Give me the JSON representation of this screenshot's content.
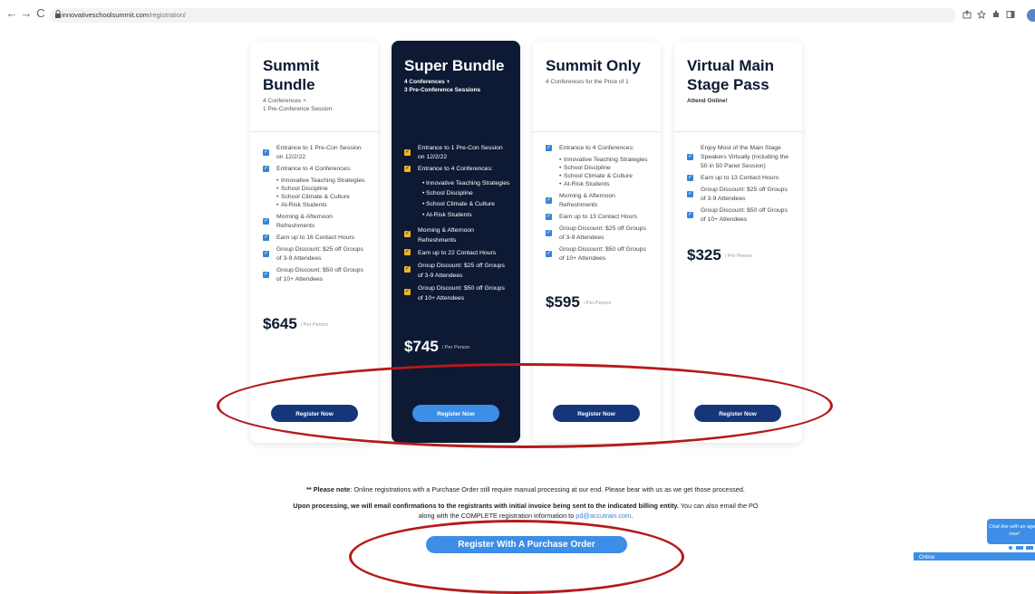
{
  "browser": {
    "url_host": "innovativeschoolsummit.com",
    "url_path": "/registration/",
    "back_glyph": "←",
    "forward_glyph": "→",
    "reload_glyph": "C"
  },
  "cards": [
    {
      "title": "Summit Bundle",
      "subtitle": "4 Conferences +\n1 Pre-Conference Session",
      "features": [
        {
          "text": "Entrance to 1 Pre-Con Session on 12/2/22"
        },
        {
          "text": "Entrance to 4 Conferences:"
        }
      ],
      "bullets": [
        "Innovative Teaching Strategies",
        "School Discipline",
        "School Climate & Culture",
        "At-Risk Students"
      ],
      "features_after": [
        {
          "text": "Morning & Afternoon Refreshments"
        },
        {
          "text": "Earn up to 16 Contact Hours"
        },
        {
          "text": "Group Discount: $25 off Groups of 3-9 Attendees"
        },
        {
          "text": "Group Discount: $50 off Groups of 10+ Attendees"
        }
      ],
      "price": "$645",
      "per": "/ Per Person",
      "button": "Register Now"
    },
    {
      "title": "Super Bundle",
      "subtitle": "4 Conferences +\n3 Pre-Conference Sessions",
      "features": [
        {
          "text": "Entrance to 1 Pre-Con Session on 12/2/22"
        },
        {
          "text": "Entrance to 4 Conferences:"
        }
      ],
      "bullets": [
        "Innovative Teaching Strategies",
        "School Discipline",
        "School Climate & Culture",
        "At-Risk Students"
      ],
      "features_after": [
        {
          "text": "Morning & Afternoon Refreshments"
        },
        {
          "text": "Earn up to 22 Contact Hours"
        },
        {
          "text": "Group Discount: $25 off Groups of 3-9 Attendees"
        },
        {
          "text": "Group Discount: $50 off Groups of 10+ Attendees"
        }
      ],
      "price": "$745",
      "per": "/ Per Person",
      "button": "Register Now"
    },
    {
      "title": "Summit Only",
      "subtitle": "4 Conferences for the Price of 1",
      "features": [
        {
          "text": "Entrance to 4 Conferences:"
        }
      ],
      "bullets": [
        "Innovative Teaching Strategies",
        "School Discipline",
        "School Climate & Culture",
        "At-Risk Students"
      ],
      "features_after": [
        {
          "text": "Morning & Afternoon Refreshments"
        },
        {
          "text": "Earn up to 13 Contact Hours"
        },
        {
          "text": "Group Discount: $25 off Groups of 3-9 Attendees"
        },
        {
          "text": "Group Discount: $50 off Groups of 10+ Attendees"
        }
      ],
      "price": "$595",
      "per": "/ Per Person",
      "button": "Register Now"
    },
    {
      "title": "Virtual Main Stage Pass",
      "subtitle": "Attend Online!",
      "features": [
        {
          "text": "Enjoy Most of the Main Stage Speakers Virtually (including the 50 in 50 Panel Session)"
        },
        {
          "text": "Earn up to 13 Contact Hours"
        },
        {
          "text": "Group Discount: $25 off Groups of 3-9 Attendees"
        },
        {
          "text": "Group Discount: $50 off Groups of 10+ Attendees"
        }
      ],
      "price": "$325",
      "per": "/ Per Person",
      "button": "Register Now"
    }
  ],
  "notes": {
    "line1_bold": "** Please note",
    "line1_rest": ": Online registrations with a Purchase Order still require manual processing at our end. Please bear with us as we get those processed.",
    "line2_bold": "Upon processing, we will email confirmations to the registrants with initial invoice being sent to the indicated billing entity.",
    "line2_rest": " You can also email the PO",
    "line3": "along with the COMPLETE registration information to ",
    "line3_link": "pd@accutrain.com",
    "line3_end": "."
  },
  "po_button": "Register With A Purchase Order",
  "chat": {
    "bubble": "Chat live with an agent now!",
    "status": "Online"
  },
  "colors": {
    "dark_card": "#0e1a33",
    "button_navy": "#15377a",
    "button_blue": "#3d8ee6",
    "check_blue": "#3b82d8",
    "check_gold": "#f0b429",
    "annotation_red": "#b51a1a"
  }
}
